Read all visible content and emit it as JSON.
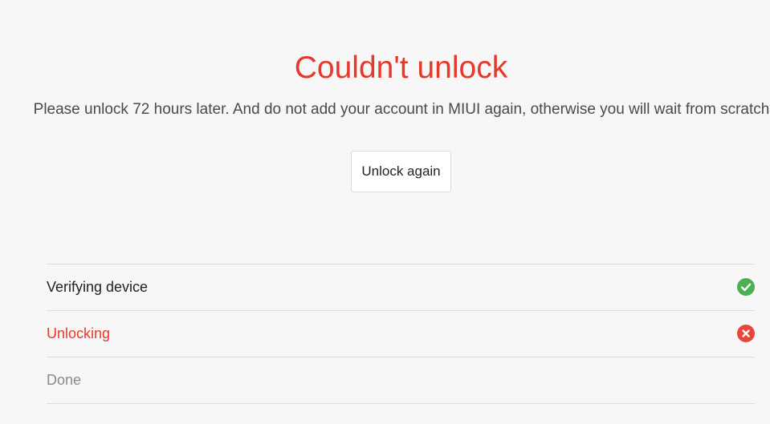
{
  "header": {
    "title": "Couldn't unlock",
    "message": "Please unlock 72 hours later. And do not add your account in MIUI again, otherwise you will wait from scratch"
  },
  "actions": {
    "unlock_again_label": "Unlock again"
  },
  "steps": [
    {
      "label": "Verifying device",
      "status": "success",
      "color": "#222222",
      "icon": "check-circle-icon",
      "icon_color": "#4caf50"
    },
    {
      "label": "Unlocking",
      "status": "failed",
      "color": "#e6382b",
      "icon": "x-circle-icon",
      "icon_color": "#e8463a"
    },
    {
      "label": "Done",
      "status": "pending",
      "color": "#8a8a8a"
    }
  ],
  "colors": {
    "accent_error": "#e6382b",
    "success": "#4caf50",
    "background": "#f7f7f7"
  }
}
